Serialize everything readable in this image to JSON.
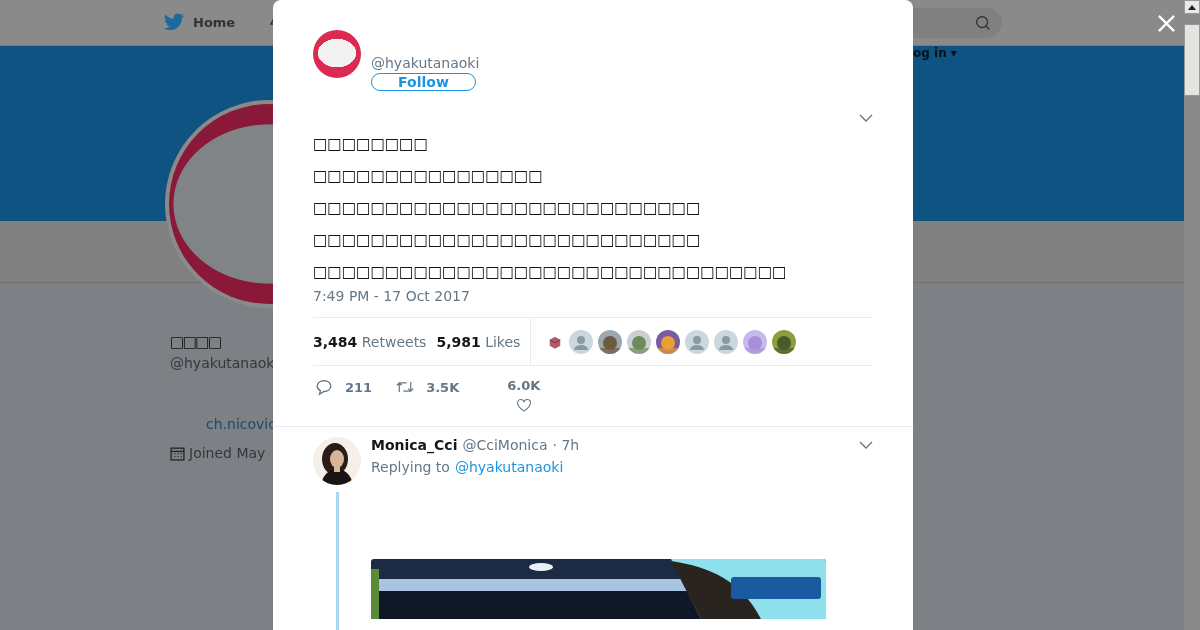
{
  "background_page": {
    "nav_home": "Home",
    "login": "og in ▾",
    "profile": {
      "name": "□□□□",
      "handle": "@hyakutanaok",
      "link": "ch.nicovic",
      "joined": "Joined May"
    }
  },
  "tweet": {
    "handle": "@hyakutanaoki",
    "follow": "Follow",
    "lines": [
      "□□□□□□□□",
      "□□□□□□□□□□□□□□□□",
      "□□□□□□□□□□□□□□□□□□□□□□□□□□□",
      "□□□□□□□□□□□□□□□□□□□□□□□□□□□",
      "□□□□□□□□□□□□□□□□□□□□□□□□□□□□□□□□□"
    ],
    "timestamp": "7:49 PM - 17 Oct 2017",
    "retweets": {
      "count": "3,484",
      "label": "Retweets"
    },
    "likes": {
      "count": "5,981",
      "label": "Likes"
    },
    "likers": [
      {
        "kind": "picture"
      },
      {
        "kind": "default"
      },
      {
        "kind": "picture"
      },
      {
        "kind": "picture"
      },
      {
        "kind": "picture"
      },
      {
        "kind": "default"
      },
      {
        "kind": "default"
      },
      {
        "kind": "picture"
      },
      {
        "kind": "picture"
      }
    ],
    "actions": {
      "replies": "211",
      "retweets": "3.5K",
      "likes": "6.0K"
    }
  },
  "reply": {
    "name": "Monica_Cci",
    "handle": "@CciMonica",
    "time": "· 7h",
    "replying_label": "Replying to",
    "replying_to": "@hyakutanaoki",
    "media": {
      "kind": "picture"
    }
  }
}
